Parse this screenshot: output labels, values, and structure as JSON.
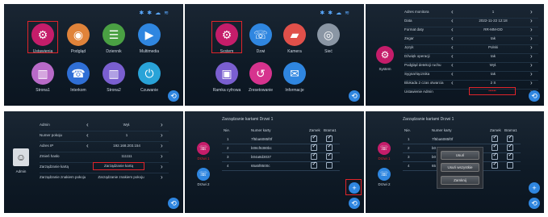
{
  "panel1": {
    "menu": [
      {
        "label": "Ustawienia",
        "icon": "gear-icon",
        "color": "#c51d6a"
      },
      {
        "label": "Podgląd",
        "icon": "camera-icon",
        "color": "#e0833a"
      },
      {
        "label": "Dziennik",
        "icon": "notebook-icon",
        "color": "#4aa043"
      },
      {
        "label": "Multimedia",
        "icon": "media-icon",
        "color": "#2f86e0"
      },
      {
        "label": "Strona1",
        "icon": "door-icon",
        "color": "#b86ac8"
      },
      {
        "label": "Interkom",
        "icon": "intercom-icon",
        "color": "#2f6fd6"
      },
      {
        "label": "Strona2",
        "icon": "door-icon",
        "color": "#7a5fd0"
      },
      {
        "label": "Czuwanie",
        "icon": "power-icon",
        "color": "#29a3d8"
      }
    ]
  },
  "panel2": {
    "menu": [
      {
        "label": "System",
        "icon": "gear-icon",
        "color": "#c51d6a"
      },
      {
        "label": "Dzwi",
        "icon": "door-phone-icon",
        "color": "#2f86e0"
      },
      {
        "label": "Kamera",
        "icon": "cctv-icon",
        "color": "#e0504a"
      },
      {
        "label": "Sieć",
        "icon": "network-icon",
        "color": "#8a96a4"
      },
      {
        "label": "Ramka cyfrowa",
        "icon": "picture-icon",
        "color": "#7a5fd0"
      },
      {
        "label": "Zresetowanie",
        "icon": "reset-icon",
        "color": "#d6338e"
      },
      {
        "label": "Informacje",
        "icon": "mail-icon",
        "color": "#2f86e0"
      }
    ]
  },
  "panel3": {
    "side_label": "System",
    "rows": [
      {
        "key": "Adres monitora",
        "value": "1"
      },
      {
        "key": "Data",
        "value": "2022-11-22 12:18"
      },
      {
        "key": "Format daty",
        "value": "RR-MM-DD"
      },
      {
        "key": "Zegar",
        "value": "tak"
      },
      {
        "key": "Język",
        "value": "Polski"
      },
      {
        "key": "Dźwięk operacji",
        "value": "tak"
      },
      {
        "key": "Podgląd detekcji ruchu",
        "value": "Wył."
      },
      {
        "key": "Sygnał łącznika",
        "value": "tak"
      },
      {
        "key": "Blokada 2 czas otwarcia",
        "value": "2 S"
      },
      {
        "key": "Ustawienie Admin",
        "value": "••••••"
      }
    ]
  },
  "panel4": {
    "side_label": "Admin",
    "rows": [
      {
        "key": "Admin",
        "value": "Wył."
      },
      {
        "key": "Numer pokoju",
        "value": "1"
      },
      {
        "key": "Adres IP",
        "value": "192.168.203.154"
      },
      {
        "key": "Zmień hasło",
        "value": "111111"
      },
      {
        "key": "Zarządzanie kartą",
        "value": "Zarządzanie kartą"
      },
      {
        "key": "Zarządzanie znakiem pokoju",
        "value": "Zarządzanie znakiem pokoju"
      }
    ]
  },
  "panel5": {
    "title": "Zarządzanie kartami Drzwi 1",
    "headers": {
      "no": "Nie.",
      "card": "Numer karty",
      "lock": "Zamek",
      "gate": "Brama1"
    },
    "rows": [
      {
        "no": "1",
        "card": "7f5ba6085f0f",
        "lock": true,
        "gate": true
      },
      {
        "no": "2",
        "card": "b08cf6380bc",
        "lock": true,
        "gate": true
      },
      {
        "no": "3",
        "card": "b04a8d3037",
        "lock": true,
        "gate": true
      },
      {
        "no": "4",
        "card": "65a5f8500c",
        "lock": true,
        "gate": false
      }
    ],
    "doors": [
      {
        "label": "Drzwi 1",
        "color": "#c51d6a"
      },
      {
        "label": "Drzwi 2",
        "color": "#2f86e0"
      }
    ]
  },
  "panel6": {
    "title": "Zarządzanie kartami Drzwi 1",
    "headers": {
      "no": "Nie.",
      "card": "Numer karty",
      "lock": "Zamek",
      "gate": "Brama1"
    },
    "rows": [
      {
        "no": "1",
        "card": "7f5ba6085f0f",
        "lock": true,
        "gate": true
      },
      {
        "no": "2",
        "card": "b0",
        "lock": true,
        "gate": true
      },
      {
        "no": "3",
        "card": "b0",
        "lock": true,
        "gate": true
      },
      {
        "no": "4",
        "card": "65",
        "lock": true,
        "gate": false
      }
    ],
    "popup": {
      "delete": "Usuń",
      "delete_all": "Usuń wszystkie",
      "cancel": "Zamknij"
    },
    "doors": [
      {
        "label": "Drzwi 1",
        "color": "#c51d6a"
      },
      {
        "label": "Drzwi 2",
        "color": "#2f86e0"
      }
    ]
  },
  "glyphs": {
    "back": "⟲",
    "plus": "+",
    "left": "‹",
    "right": "›",
    "check": "✓",
    "status": [
      "✱",
      "✱",
      "☁",
      "≋"
    ]
  }
}
